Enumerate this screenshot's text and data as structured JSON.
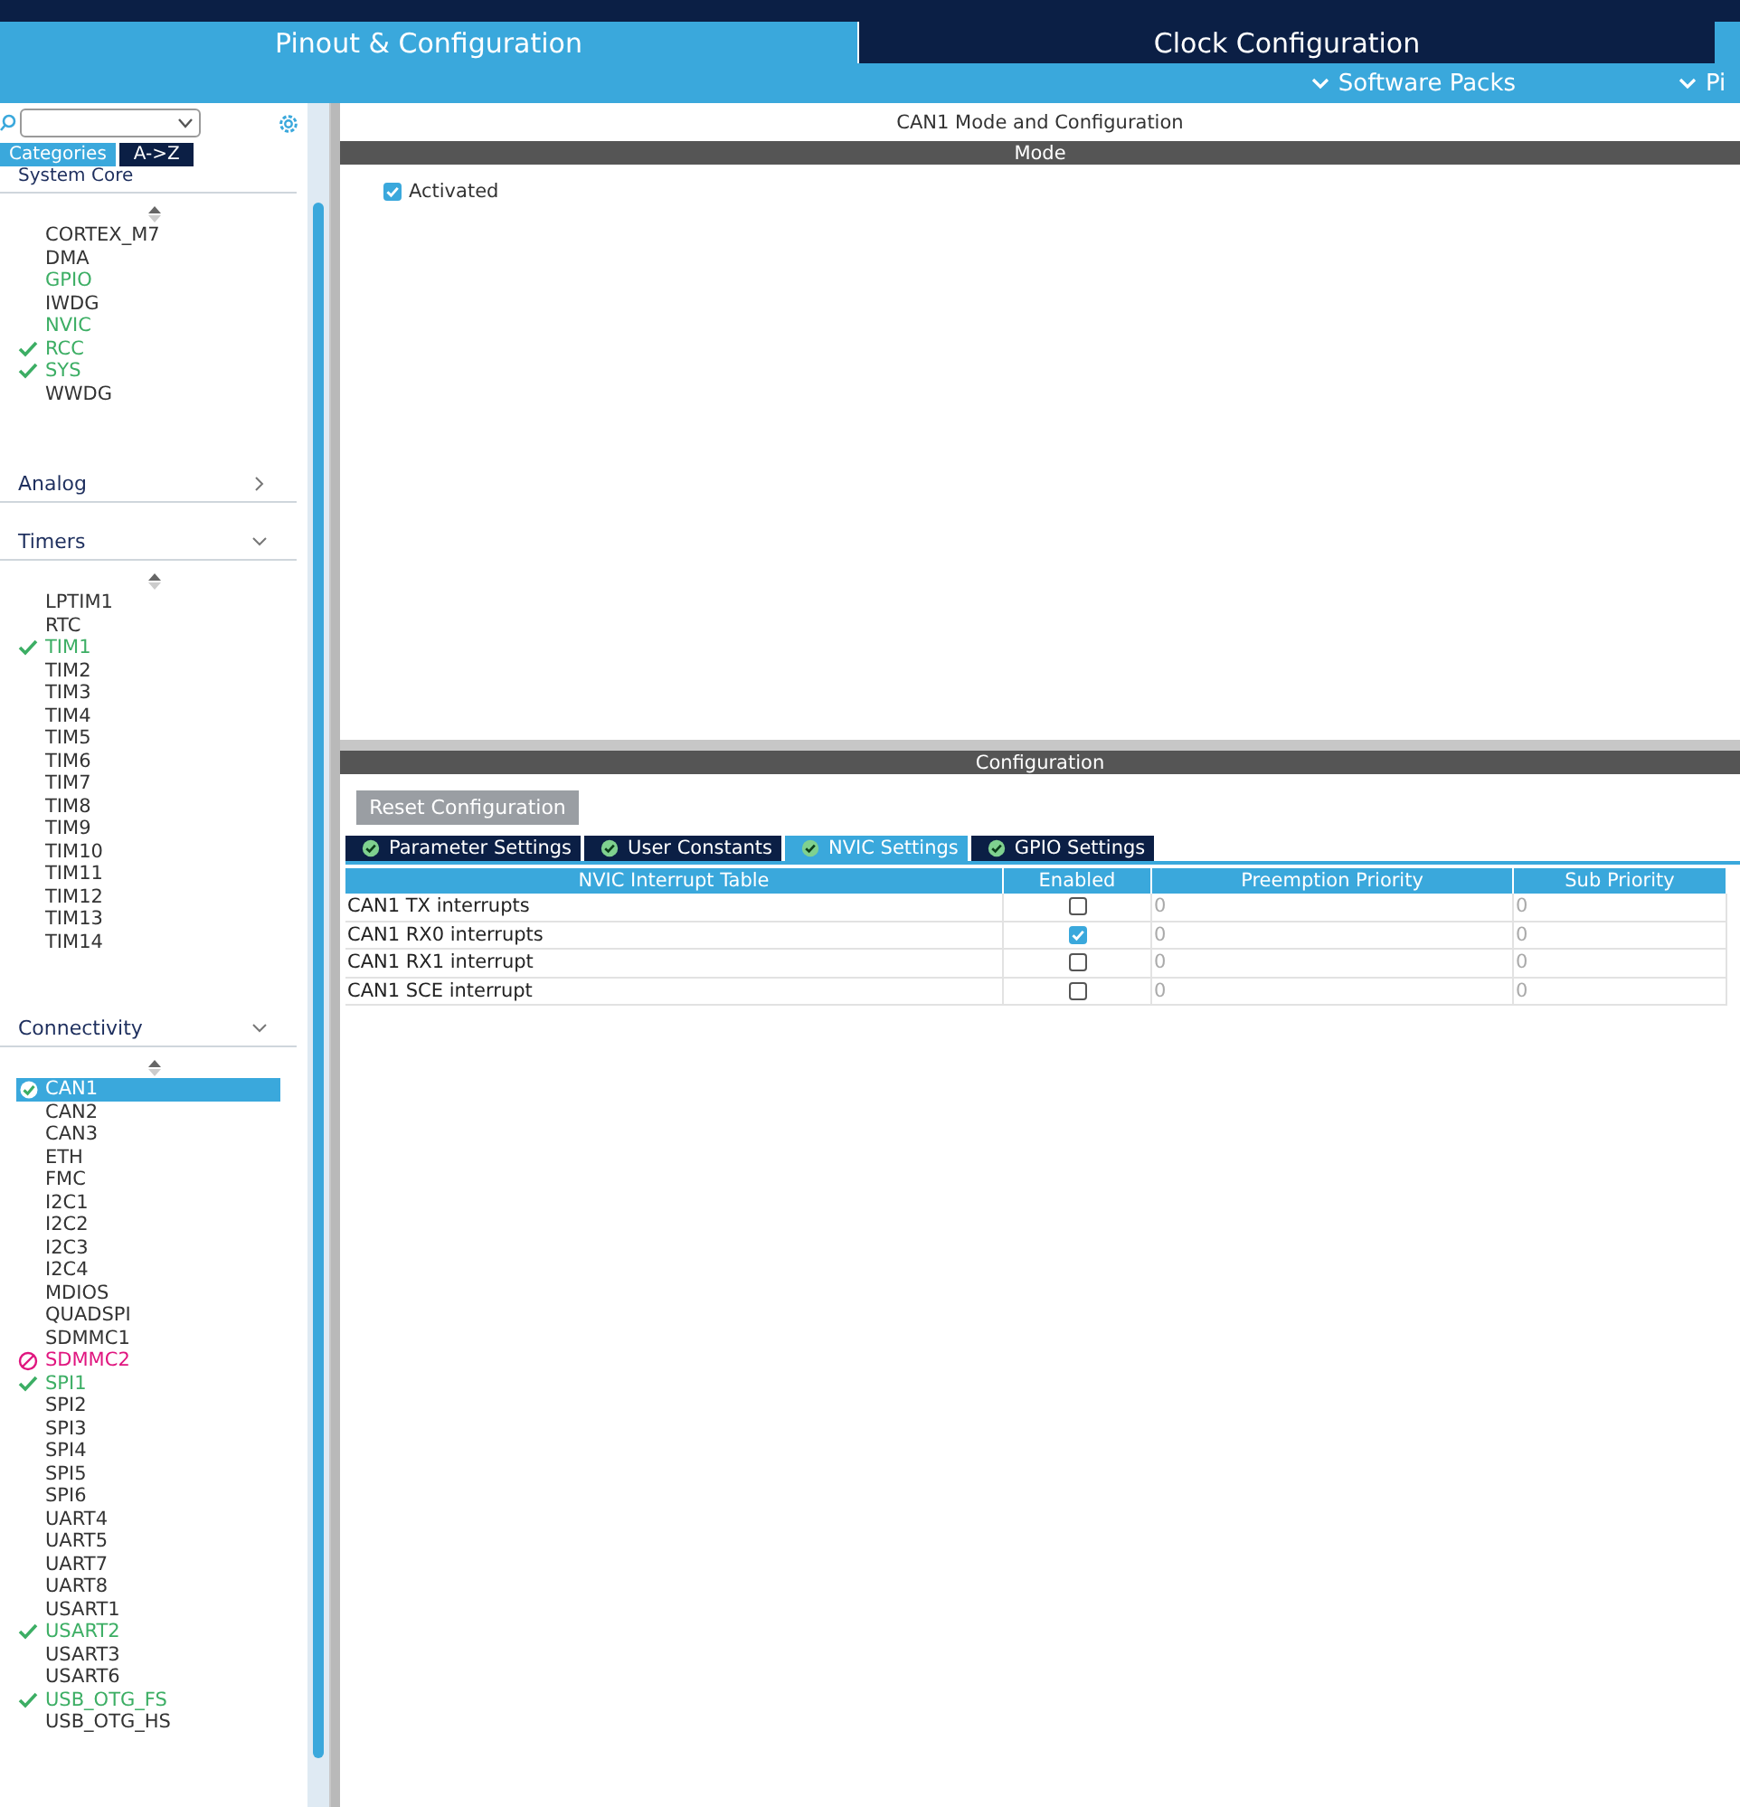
{
  "main_tabs": [
    {
      "label": "Pinout & Configuration",
      "selected": true
    },
    {
      "label": "Clock Configuration",
      "selected": false
    }
  ],
  "sub_menu": [
    "Software Packs",
    "Pi"
  ],
  "sidebar": {
    "view_tabs": [
      {
        "label": "Categories",
        "selected": true
      },
      {
        "label": "A->Z",
        "selected": false
      }
    ],
    "sections": [
      {
        "title": "System Core",
        "expanded": true,
        "items": [
          {
            "label": "CORTEX_M7",
            "color": "#333333",
            "checked": false,
            "blocked": false,
            "selected": false
          },
          {
            "label": "DMA",
            "color": "#333333",
            "checked": false,
            "blocked": false,
            "selected": false
          },
          {
            "label": "GPIO",
            "color": "#3cae64",
            "checked": false,
            "blocked": false,
            "selected": false
          },
          {
            "label": "IWDG",
            "color": "#333333",
            "checked": false,
            "blocked": false,
            "selected": false
          },
          {
            "label": "NVIC",
            "color": "#3cae64",
            "checked": false,
            "blocked": false,
            "selected": false
          },
          {
            "label": "RCC",
            "color": "#3cae64",
            "checked": true,
            "blocked": false,
            "selected": false
          },
          {
            "label": "SYS",
            "color": "#3cae64",
            "checked": true,
            "blocked": false,
            "selected": false
          },
          {
            "label": "WWDG",
            "color": "#333333",
            "checked": false,
            "blocked": false,
            "selected": false
          }
        ]
      },
      {
        "title": "Analog",
        "expanded": false
      },
      {
        "title": "Timers",
        "expanded": true,
        "items": [
          {
            "label": "LPTIM1",
            "color": "#333333",
            "checked": false,
            "blocked": false,
            "selected": false
          },
          {
            "label": "RTC",
            "color": "#333333",
            "checked": false,
            "blocked": false,
            "selected": false
          },
          {
            "label": "TIM1",
            "color": "#3cae64",
            "checked": true,
            "blocked": false,
            "selected": false
          },
          {
            "label": "TIM2",
            "color": "#333333",
            "checked": false,
            "blocked": false,
            "selected": false
          },
          {
            "label": "TIM3",
            "color": "#333333",
            "checked": false,
            "blocked": false,
            "selected": false
          },
          {
            "label": "TIM4",
            "color": "#333333",
            "checked": false,
            "blocked": false,
            "selected": false
          },
          {
            "label": "TIM5",
            "color": "#333333",
            "checked": false,
            "blocked": false,
            "selected": false
          },
          {
            "label": "TIM6",
            "color": "#333333",
            "checked": false,
            "blocked": false,
            "selected": false
          },
          {
            "label": "TIM7",
            "color": "#333333",
            "checked": false,
            "blocked": false,
            "selected": false
          },
          {
            "label": "TIM8",
            "color": "#333333",
            "checked": false,
            "blocked": false,
            "selected": false
          },
          {
            "label": "TIM9",
            "color": "#333333",
            "checked": false,
            "blocked": false,
            "selected": false
          },
          {
            "label": "TIM10",
            "color": "#333333",
            "checked": false,
            "blocked": false,
            "selected": false
          },
          {
            "label": "TIM11",
            "color": "#333333",
            "checked": false,
            "blocked": false,
            "selected": false
          },
          {
            "label": "TIM12",
            "color": "#333333",
            "checked": false,
            "blocked": false,
            "selected": false
          },
          {
            "label": "TIM13",
            "color": "#333333",
            "checked": false,
            "blocked": false,
            "selected": false
          },
          {
            "label": "TIM14",
            "color": "#333333",
            "checked": false,
            "blocked": false,
            "selected": false
          }
        ]
      },
      {
        "title": "Connectivity",
        "expanded": true,
        "items": [
          {
            "label": "CAN1",
            "checked": true,
            "blocked": false,
            "selected": true
          },
          {
            "label": "CAN2",
            "color": "#333333",
            "checked": false,
            "blocked": false,
            "selected": false
          },
          {
            "label": "CAN3",
            "color": "#333333",
            "checked": false,
            "blocked": false,
            "selected": false
          },
          {
            "label": "ETH",
            "color": "#333333",
            "checked": false,
            "blocked": false,
            "selected": false
          },
          {
            "label": "FMC",
            "color": "#333333",
            "checked": false,
            "blocked": false,
            "selected": false
          },
          {
            "label": "I2C1",
            "color": "#333333",
            "checked": false,
            "blocked": false,
            "selected": false
          },
          {
            "label": "I2C2",
            "color": "#333333",
            "checked": false,
            "blocked": false,
            "selected": false
          },
          {
            "label": "I2C3",
            "color": "#333333",
            "checked": false,
            "blocked": false,
            "selected": false
          },
          {
            "label": "I2C4",
            "color": "#333333",
            "checked": false,
            "blocked": false,
            "selected": false
          },
          {
            "label": "MDIOS",
            "color": "#333333",
            "checked": false,
            "blocked": false,
            "selected": false
          },
          {
            "label": "QUADSPI",
            "color": "#333333",
            "checked": false,
            "blocked": false,
            "selected": false
          },
          {
            "label": "SDMMC1",
            "color": "#333333",
            "checked": false,
            "blocked": false,
            "selected": false
          },
          {
            "label": "SDMMC2",
            "color": "#e0157f",
            "checked": false,
            "blocked": true,
            "selected": false
          },
          {
            "label": "SPI1",
            "color": "#3cae64",
            "checked": true,
            "blocked": false,
            "selected": false
          },
          {
            "label": "SPI2",
            "color": "#333333",
            "checked": false,
            "blocked": false,
            "selected": false
          },
          {
            "label": "SPI3",
            "color": "#333333",
            "checked": false,
            "blocked": false,
            "selected": false
          },
          {
            "label": "SPI4",
            "color": "#333333",
            "checked": false,
            "blocked": false,
            "selected": false
          },
          {
            "label": "SPI5",
            "color": "#333333",
            "checked": false,
            "blocked": false,
            "selected": false
          },
          {
            "label": "SPI6",
            "color": "#333333",
            "checked": false,
            "blocked": false,
            "selected": false
          },
          {
            "label": "UART4",
            "color": "#333333",
            "checked": false,
            "blocked": false,
            "selected": false
          },
          {
            "label": "UART5",
            "color": "#333333",
            "checked": false,
            "blocked": false,
            "selected": false
          },
          {
            "label": "UART7",
            "color": "#333333",
            "checked": false,
            "blocked": false,
            "selected": false
          },
          {
            "label": "UART8",
            "color": "#333333",
            "checked": false,
            "blocked": false,
            "selected": false
          },
          {
            "label": "USART1",
            "color": "#333333",
            "checked": false,
            "blocked": false,
            "selected": false
          },
          {
            "label": "USART2",
            "color": "#3cae64",
            "checked": true,
            "blocked": false,
            "selected": false
          },
          {
            "label": "USART3",
            "color": "#333333",
            "checked": false,
            "blocked": false,
            "selected": false
          },
          {
            "label": "USART6",
            "color": "#333333",
            "checked": false,
            "blocked": false,
            "selected": false
          },
          {
            "label": "USB_OTG_FS",
            "color": "#3cae64",
            "checked": true,
            "blocked": false,
            "selected": false
          },
          {
            "label": "USB_OTG_HS",
            "color": "#333333",
            "checked": false,
            "blocked": false,
            "selected": false
          }
        ]
      }
    ]
  },
  "panel": {
    "title": "CAN1 Mode and Configuration",
    "mode_header": "Mode",
    "activated": {
      "label": "Activated",
      "checked": true
    },
    "config_header": "Configuration",
    "reset_button": "Reset Configuration",
    "config_tabs": [
      {
        "label": "Parameter Settings",
        "selected": false
      },
      {
        "label": "User Constants",
        "selected": false
      },
      {
        "label": "NVIC Settings",
        "selected": true
      },
      {
        "label": "GPIO Settings",
        "selected": false
      }
    ],
    "table": {
      "columns": [
        "NVIC Interrupt Table",
        "Enabled",
        "Preemption Priority",
        "Sub Priority"
      ],
      "rows": [
        {
          "name": "CAN1 TX interrupts",
          "enabled": false,
          "preemption": "0",
          "sub": "0"
        },
        {
          "name": "CAN1 RX0 interrupts",
          "enabled": true,
          "preemption": "0",
          "sub": "0"
        },
        {
          "name": "CAN1 RX1 interrupt",
          "enabled": false,
          "preemption": "0",
          "sub": "0"
        },
        {
          "name": "CAN1 SCE interrupt",
          "enabled": false,
          "preemption": "0",
          "sub": "0"
        }
      ]
    }
  }
}
